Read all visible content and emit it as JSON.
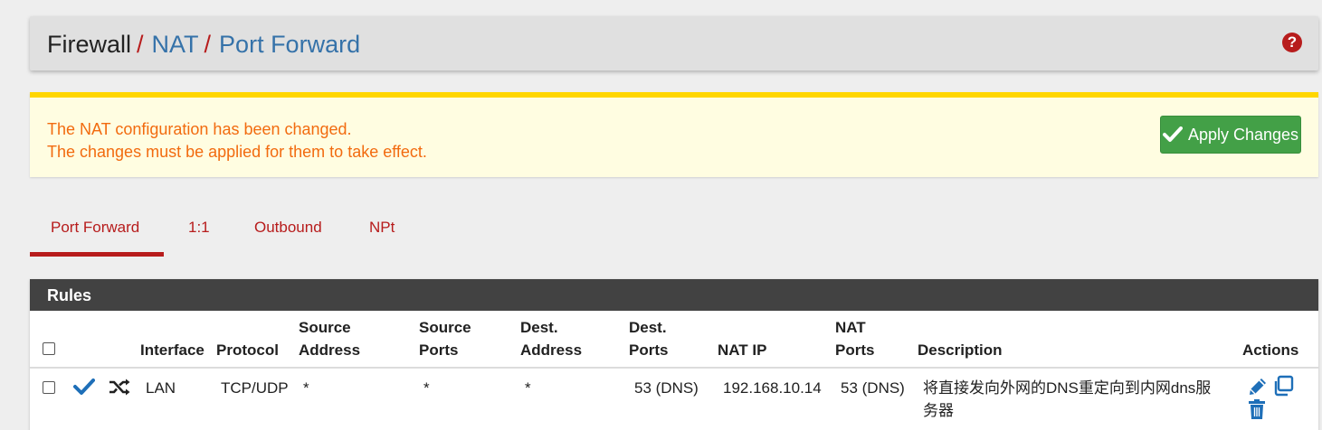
{
  "breadcrumb": {
    "firewall": "Firewall",
    "nat": "NAT",
    "port_forward": "Port Forward",
    "separator": "/"
  },
  "help": {
    "glyph": "?"
  },
  "alert": {
    "line1": "The NAT configuration has been changed.",
    "line2": "The changes must be applied for them to take effect.",
    "apply_label": "Apply Changes"
  },
  "tabs": [
    {
      "label": "Port Forward",
      "active": true
    },
    {
      "label": "1:1",
      "active": false
    },
    {
      "label": "Outbound",
      "active": false
    },
    {
      "label": "NPt",
      "active": false
    }
  ],
  "rules": {
    "title": "Rules",
    "headers": {
      "interface": "Interface",
      "protocol": "Protocol",
      "source_address_1": "Source",
      "source_address_2": "Address",
      "source_ports_1": "Source",
      "source_ports_2": "Ports",
      "dest_address_1": "Dest.",
      "dest_address_2": "Address",
      "dest_ports_1": "Dest.",
      "dest_ports_2": "Ports",
      "nat_ip": "NAT IP",
      "nat_ports_1": "NAT",
      "nat_ports_2": "Ports",
      "description": "Description",
      "actions": "Actions"
    },
    "rows": [
      {
        "interface": "LAN",
        "protocol": "TCP/UDP",
        "source_address": "*",
        "source_ports": "*",
        "dest_address": "*",
        "dest_ports": "53 (DNS)",
        "nat_ip": "192.168.10.14",
        "nat_ports": "53 (DNS)",
        "description_1": "将直接发向外网的DNS重定向到内网dns服",
        "description_2": "务器"
      }
    ]
  },
  "colors": {
    "accent_red": "#b71c1c",
    "link_blue": "#3572a9",
    "alert_text": "#f26b0f",
    "alert_border": "#ffd600",
    "success_green": "#43a047",
    "panel_header": "#424242",
    "icon_blue": "#1e6fb8"
  }
}
